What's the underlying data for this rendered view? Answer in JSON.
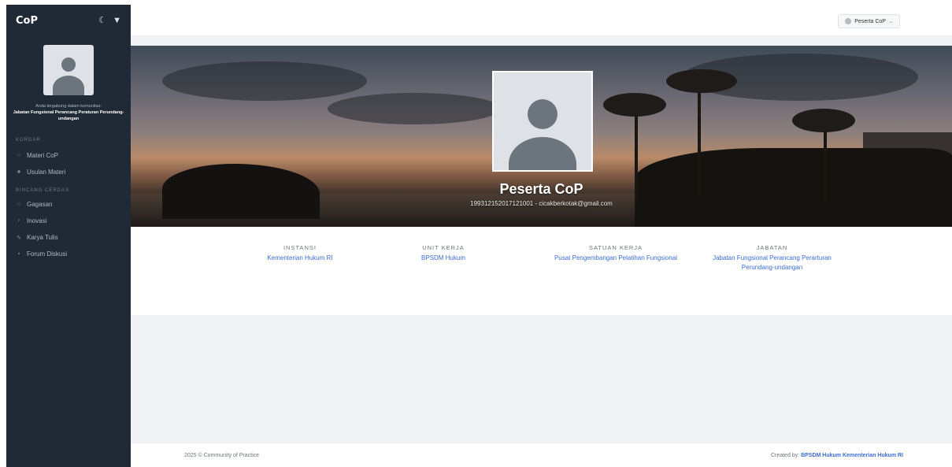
{
  "app": {
    "title": "CoP"
  },
  "sidebar": {
    "member_text": "Anda tergabung dalam komunitas:",
    "member_group": "Jabatan Fungsional Perancang Peraturan Perundang-undangan",
    "sections": [
      {
        "label": "KORDAR",
        "items": [
          {
            "label": "Materi CoP",
            "icon": "circle-icon"
          },
          {
            "label": "Usulan Materi",
            "icon": "users-icon"
          }
        ]
      },
      {
        "label": "BINCANG CERDAS",
        "items": [
          {
            "label": "Gagasan",
            "icon": "chat-icon"
          },
          {
            "label": "Inovasi",
            "icon": "lightbulb-icon"
          },
          {
            "label": "Karya Tulis",
            "icon": "pen-icon"
          },
          {
            "label": "Forum Diskusi",
            "icon": "comments-icon"
          }
        ]
      }
    ]
  },
  "header": {
    "user_label": "Peserta CoP"
  },
  "profile": {
    "name": "Peserta CoP",
    "subtitle": "199312152017121001 - cicakberkotak@gmail.com"
  },
  "info": [
    {
      "label": "INSTANSI",
      "value": "Kementerian Hukum RI"
    },
    {
      "label": "UNIT KERJA",
      "value": "BPSDM Hukum"
    },
    {
      "label": "SATUAN KERJA",
      "value": "Pusat Pengembangan Pelatihan Fungsional"
    },
    {
      "label": "JABATAN",
      "value": "Jabatan Fungsional Perancang Perarturan Perundang-undangan"
    }
  ],
  "footer": {
    "copyright": "2025 © Community of Practice",
    "created_prefix": "Created by:",
    "created_link": "BPSDM Hukum Kementerian Hukum RI"
  },
  "colors": {
    "sidebar_bg": "#1f2a36",
    "link": "#3b6ed6",
    "content_bg": "#f0f2f5"
  }
}
